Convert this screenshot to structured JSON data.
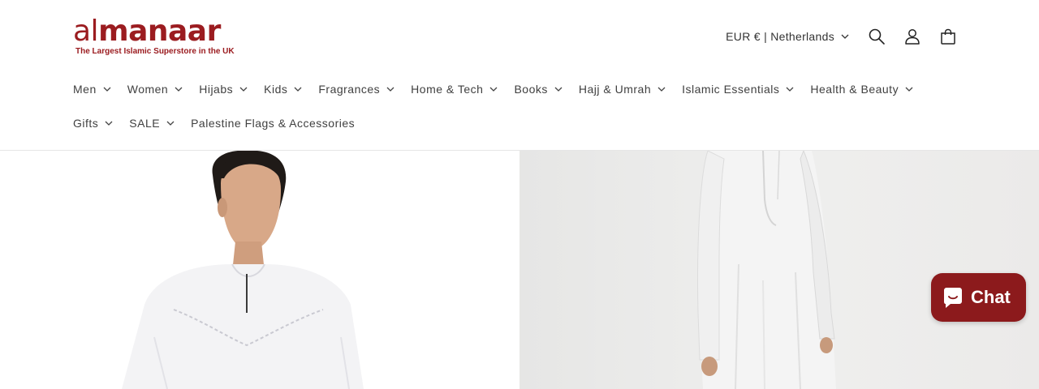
{
  "brand": {
    "logo_part1": "al",
    "logo_part2": "manaar",
    "tagline": "The Largest Islamic Superstore in the UK",
    "accent_color": "#9b1c20"
  },
  "header": {
    "country_selector": "EUR € | Netherlands",
    "icons": [
      "search-icon",
      "account-icon",
      "cart-icon"
    ]
  },
  "nav": {
    "items": [
      {
        "label": "Men"
      },
      {
        "label": "Women"
      },
      {
        "label": "Hijabs"
      },
      {
        "label": "Kids"
      },
      {
        "label": "Fragrances"
      },
      {
        "label": "Home & Tech"
      },
      {
        "label": "Books"
      },
      {
        "label": "Hajj & Umrah"
      },
      {
        "label": "Islamic Essentials"
      },
      {
        "label": "Health & Beauty"
      },
      {
        "label": "Gifts"
      },
      {
        "label": "SALE"
      },
      {
        "label": "Palestine Flags & Accessories"
      }
    ]
  },
  "chat": {
    "label": "Chat",
    "color": "#8c1a1c"
  }
}
